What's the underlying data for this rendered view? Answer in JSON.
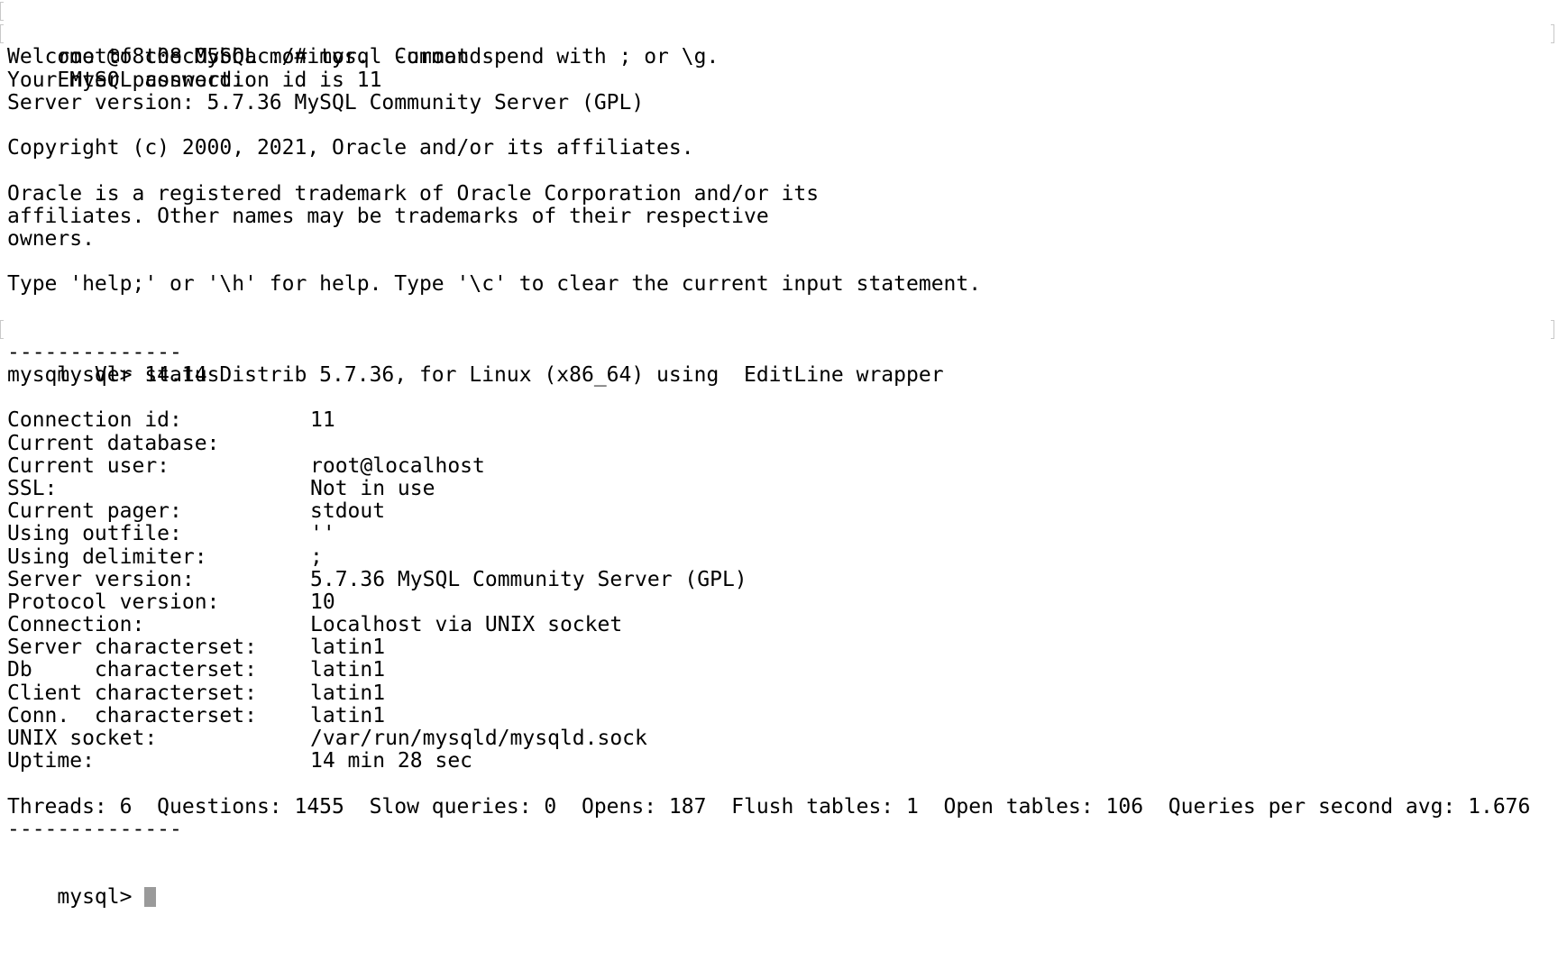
{
  "terminal": {
    "shell_prompt": "root@f8c08c05bbac:/# ",
    "shell_command": "mysql -uroot -p",
    "enter_password": "Enter password:",
    "welcome": "Welcome to the MySQL monitor.  Commands end with ; or \\g.",
    "connection_line": "Your MySQL connection id is 11",
    "server_version_line": "Server version: 5.7.36 MySQL Community Server (GPL)",
    "copyright": "Copyright (c) 2000, 2021, Oracle and/or its affiliates.",
    "trademark_1": "Oracle is a registered trademark of Oracle Corporation and/or its",
    "trademark_2": "affiliates. Other names may be trademarks of their respective",
    "trademark_3": "owners.",
    "help_hint": "Type 'help;' or '\\h' for help. Type '\\c' to clear the current input statement.",
    "mysql_prompt": "mysql> ",
    "status_command": "status",
    "separator": "--------------",
    "version_info": "mysql  Ver 14.14 Distrib 5.7.36, for Linux (x86_64) using  EditLine wrapper",
    "status_rows": [
      {
        "key": "Connection id:",
        "value": "11"
      },
      {
        "key": "Current database:",
        "value": ""
      },
      {
        "key": "Current user:",
        "value": "root@localhost"
      },
      {
        "key": "SSL:",
        "value": "Not in use"
      },
      {
        "key": "Current pager:",
        "value": "stdout"
      },
      {
        "key": "Using outfile:",
        "value": "''"
      },
      {
        "key": "Using delimiter:",
        "value": ";"
      },
      {
        "key": "Server version:",
        "value": "5.7.36 MySQL Community Server (GPL)"
      },
      {
        "key": "Protocol version:",
        "value": "10"
      },
      {
        "key": "Connection:",
        "value": "Localhost via UNIX socket"
      },
      {
        "key": "Server characterset:",
        "value": "latin1"
      },
      {
        "key": "Db     characterset:",
        "value": "latin1"
      },
      {
        "key": "Client characterset:",
        "value": "latin1"
      },
      {
        "key": "Conn.  characterset:",
        "value": "latin1"
      },
      {
        "key": "UNIX socket:",
        "value": "/var/run/mysqld/mysqld.sock"
      },
      {
        "key": "Uptime:",
        "value": "14 min 28 sec"
      }
    ],
    "stats_line": "Threads: 6  Questions: 1455  Slow queries: 0  Opens: 187  Flush tables: 1  Open tables: 106  Queries per second avg: 1.676",
    "final_prompt": "mysql> "
  },
  "colors": {
    "background": "#ffffff",
    "text": "#000000",
    "cursor": "#9a9a9a",
    "marks": "#c8c8c8"
  }
}
